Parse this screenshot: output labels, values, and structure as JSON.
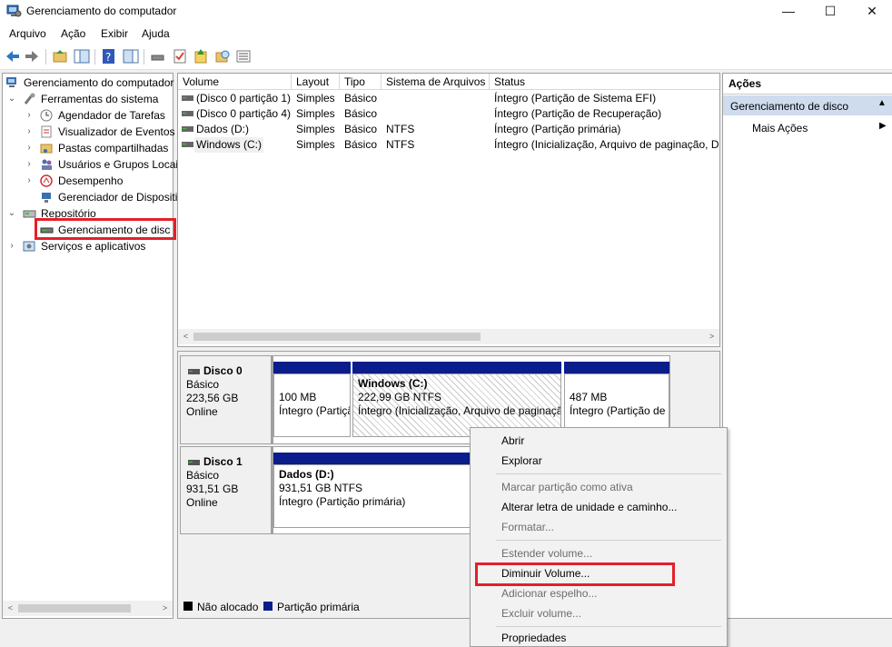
{
  "window": {
    "title": "Gerenciamento do computador",
    "minimize": "—",
    "maximize": "☐",
    "close": "✕"
  },
  "menu": [
    "Arquivo",
    "Ação",
    "Exibir",
    "Ajuda"
  ],
  "tree": {
    "root": "Gerenciamento do computador (Local)",
    "system_tools": "Ferramentas do sistema",
    "task_scheduler": "Agendador de Tarefas",
    "event_viewer": "Visualizador de Eventos",
    "shared_folders": "Pastas compartilhadas",
    "users_groups": "Usuários e Grupos Locais",
    "performance": "Desempenho",
    "device_manager": "Gerenciador de Dispositivos",
    "storage": "Repositório",
    "disk_management": "Gerenciamento de disco",
    "services": "Serviços e aplicativos"
  },
  "volume_table": {
    "headers": [
      "Volume",
      "Layout",
      "Tipo",
      "Sistema de Arquivos",
      "Status"
    ],
    "rows": [
      [
        "(Disco 0 partição 1)",
        "Simples",
        "Básico",
        "",
        "Íntegro (Partição de Sistema EFI)"
      ],
      [
        "(Disco 0 partição 4)",
        "Simples",
        "Básico",
        "",
        "Íntegro (Partição de Recuperação)"
      ],
      [
        "Dados (D:)",
        "Simples",
        "Básico",
        "NTFS",
        "Íntegro (Partição primária)"
      ],
      [
        "Windows (C:)",
        "Simples",
        "Básico",
        "NTFS",
        "Íntegro (Inicialização, Arquivo de paginação, D"
      ]
    ]
  },
  "disks": [
    {
      "name": "Disco 0",
      "type": "Básico",
      "size": "223,56 GB",
      "state": "Online",
      "partitions": [
        {
          "title": "",
          "line1": "100 MB",
          "line2": "Íntegro (Partição"
        },
        {
          "title": "Windows  (C:)",
          "line1": "222,99 GB NTFS",
          "line2": "Íntegro (Inicialização, Arquivo de paginação"
        },
        {
          "title": "",
          "line1": "487 MB",
          "line2": "Íntegro (Partição de"
        }
      ]
    },
    {
      "name": "Disco 1",
      "type": "Básico",
      "size": "931,51 GB",
      "state": "Online",
      "partitions": [
        {
          "title": "Dados  (D:)",
          "line1": "931,51 GB NTFS",
          "line2": "Íntegro (Partição primária)"
        }
      ]
    }
  ],
  "legend": {
    "unallocated": "Não alocado",
    "primary": "Partição primária"
  },
  "actions": {
    "header": "Ações",
    "section": "Gerenciamento de disco",
    "more": "Mais Ações"
  },
  "context_menu": {
    "open": "Abrir",
    "explore": "Explorar",
    "mark_active": "Marcar partição como ativa",
    "change_letter": "Alterar letra de unidade e caminho...",
    "format": "Formatar...",
    "extend": "Estender volume...",
    "shrink": "Diminuir Volume...",
    "add_mirror": "Adicionar espelho...",
    "delete": "Excluir volume...",
    "properties": "Propriedades"
  },
  "colors": {
    "highlight": "#e3202a",
    "partition_primary": "#0a1d8a",
    "unallocated": "#000000",
    "actions_selected": "#cfdcee"
  }
}
